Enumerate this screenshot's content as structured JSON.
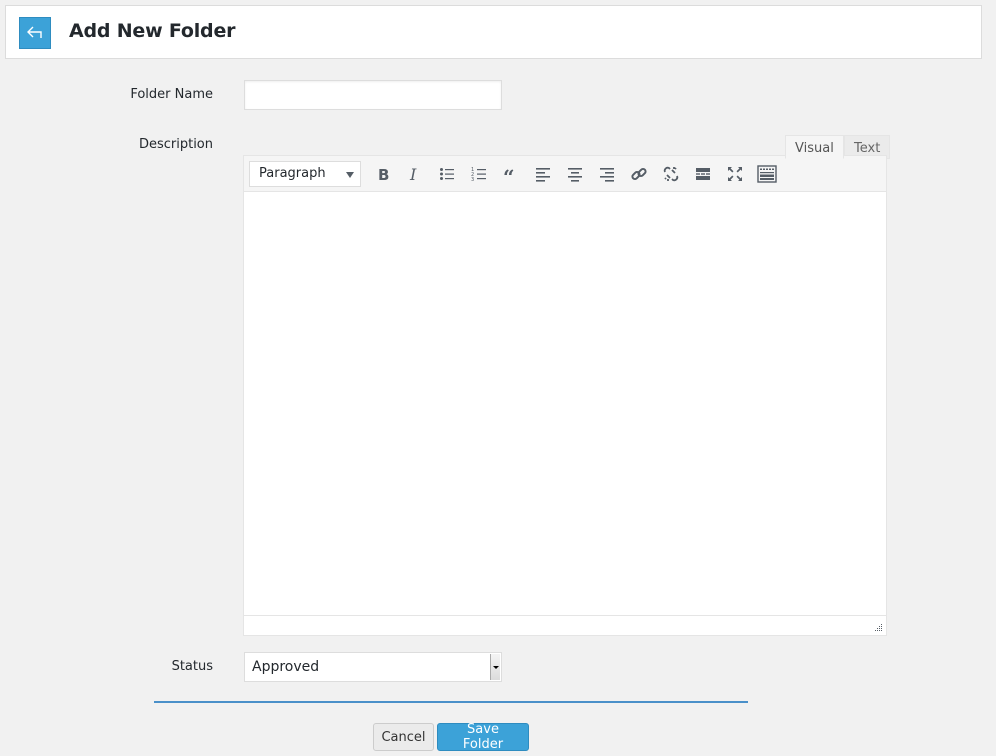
{
  "header": {
    "title": "Add New Folder",
    "back_icon": "arrow-return-left-icon",
    "accent_color": "#3ca2d8"
  },
  "form": {
    "folder_name": {
      "label": "Folder Name",
      "value": "",
      "placeholder": ""
    },
    "description": {
      "label": "Description",
      "tabs": [
        {
          "label": "Visual",
          "active": true
        },
        {
          "label": "Text",
          "active": false
        }
      ],
      "toolbar": {
        "format_select": "Paragraph",
        "buttons": [
          "bold-icon",
          "italic-icon",
          "bulleted-list-icon",
          "numbered-list-icon",
          "blockquote-icon",
          "align-left-icon",
          "align-center-icon",
          "align-right-icon",
          "insert-link-icon",
          "remove-link-icon",
          "read-more-icon",
          "fullscreen-icon",
          "toolbar-toggle-icon"
        ]
      },
      "content": ""
    },
    "status": {
      "label": "Status",
      "value": "Approved"
    }
  },
  "actions": {
    "cancel_label": "Cancel",
    "save_label": "Save Folder"
  }
}
